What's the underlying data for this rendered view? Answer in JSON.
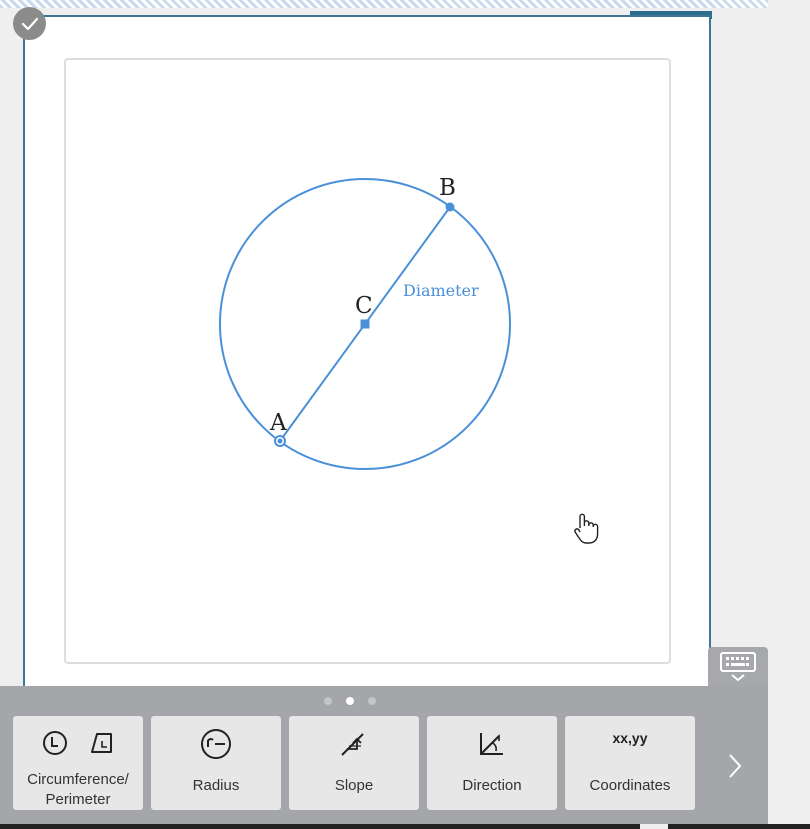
{
  "colors": {
    "circle": "#4a90d9",
    "toolbar_bg": "#a4a6a9",
    "card_border": "#3b7896"
  },
  "geometry": {
    "points": {
      "a": "A",
      "b": "B",
      "c": "C"
    },
    "segment_label": "Diameter"
  },
  "pager": {
    "pages": 3,
    "current": 2
  },
  "toolbar": {
    "tools": [
      {
        "label_line1": "Circumference/",
        "label_line2": "Perimeter",
        "icons": [
          "clock-icon",
          "trapezoid-icon"
        ]
      },
      {
        "label": "Radius",
        "icon": "radius-icon"
      },
      {
        "label": "Slope",
        "icon": "slope-icon"
      },
      {
        "label": "Direction",
        "icon": "direction-icon"
      },
      {
        "label": "Coordinates",
        "icon_text": "xx,yy"
      }
    ]
  }
}
